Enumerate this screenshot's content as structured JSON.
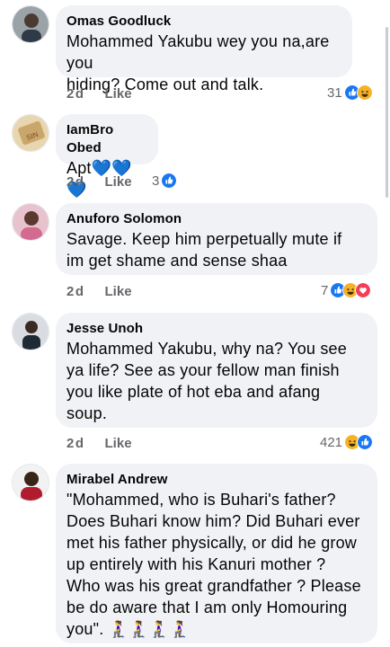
{
  "comments": [
    {
      "name": "Omas Goodluck",
      "lines": [
        "Mohammed Yakubu wey you na,are you",
        "hiding? Come out and talk."
      ],
      "time": "2d",
      "like": "Like",
      "reactions": "31"
    },
    {
      "name": "IamBro Obed",
      "lines": [
        "Apt💙💙💙"
      ],
      "time": "2d",
      "like": "Like",
      "reactions": "3"
    },
    {
      "name": "Anuforo Solomon",
      "lines": [
        "Savage. Keep him perpetually mute if",
        "im get shame and sense shaa"
      ],
      "time": "2d",
      "like": "Like",
      "reactions": "7"
    },
    {
      "name": "Jesse Unoh",
      "lines": [
        "Mohammed Yakubu, why na? You see",
        "ya life? See as your fellow man finish",
        "you like plate of hot eba and afang",
        "soup."
      ],
      "time": "2d",
      "like": "Like",
      "reactions": "421"
    },
    {
      "name": "Mirabel Andrew",
      "lines": [
        "\"Mohammed, who is Buhari's father?",
        "Does Buhari know him? Did Buhari ever",
        "met his father physically, or did he grow",
        "up entirely with his Kanuri mother ?",
        "Who was his great grandfather ? Please",
        "be do aware that I am only Homouring",
        "you\". 🧎‍♀️🧎‍♀️🧎‍♀️🧎‍♀️"
      ]
    }
  ],
  "icons": {
    "like": "like-reaction-icon",
    "haha": "haha-reaction-icon",
    "love": "love-reaction-icon"
  },
  "colors": {
    "like_blue": "#1877f2",
    "haha_yellow": "#f7b125",
    "love_red": "#f33e58",
    "bubble": "#f0f2f5",
    "meta_gray": "#65676b"
  }
}
